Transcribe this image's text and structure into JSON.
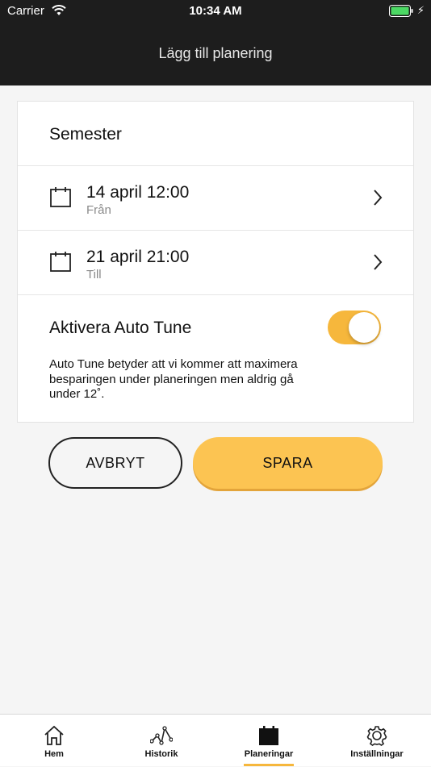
{
  "status": {
    "carrier": "Carrier",
    "time": "10:34 AM"
  },
  "nav": {
    "title": "Lägg till planering"
  },
  "form": {
    "name": "Semester",
    "from": {
      "date": "14 april 12:00",
      "label": "Från"
    },
    "to": {
      "date": "21 april 21:00",
      "label": "Till"
    },
    "auto_tune": {
      "title": "Aktivera Auto Tune",
      "enabled": true,
      "description": "Auto Tune betyder att vi kommer att maximera besparingen under planeringen men aldrig gå under 12˚."
    }
  },
  "buttons": {
    "cancel": "AVBRYT",
    "save": "SPARA"
  },
  "tabs": [
    {
      "label": "Hem",
      "icon": "home-icon"
    },
    {
      "label": "Historik",
      "icon": "history-icon"
    },
    {
      "label": "Planeringar",
      "icon": "calendar-icon",
      "active": true
    },
    {
      "label": "Inställningar",
      "icon": "gear-icon"
    }
  ],
  "colors": {
    "accent": "#f6b73c",
    "header": "#1d1d1d"
  }
}
